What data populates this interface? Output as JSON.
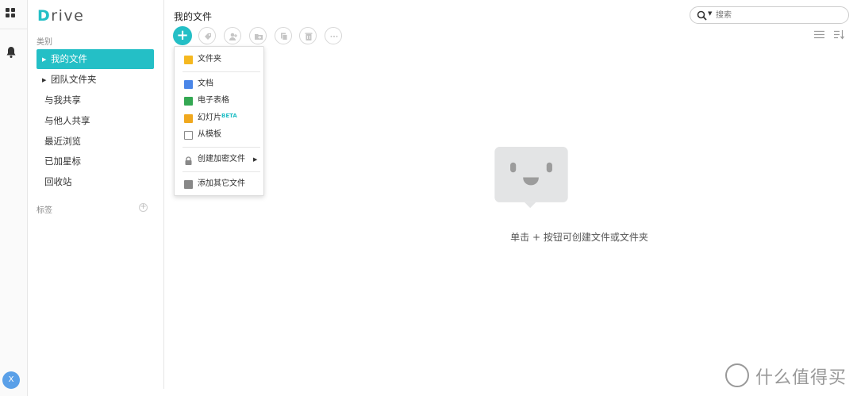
{
  "app": {
    "brand_initial": "D",
    "brand_rest": "rive"
  },
  "rail": {
    "avatar_letter": "X"
  },
  "sidebar": {
    "category_label": "类别",
    "items": [
      {
        "label": "我的文件",
        "expandable": true,
        "active": true
      },
      {
        "label": "团队文件夹",
        "expandable": true,
        "active": false
      },
      {
        "label": "与我共享"
      },
      {
        "label": "与他人共享"
      },
      {
        "label": "最近浏览"
      },
      {
        "label": "已加星标"
      },
      {
        "label": "回收站"
      }
    ],
    "tags_label": "标签",
    "tag_add": "+"
  },
  "main": {
    "title": "我的文件",
    "add_symbol": "+",
    "search_placeholder": "搜索",
    "empty_message": "单击 + 按钮可创建文件或文件夹"
  },
  "new_menu": {
    "folder": "文件夹",
    "doc": "文档",
    "sheet": "电子表格",
    "slides": "幻灯片",
    "slides_badge": "BETA",
    "template": "从模板",
    "encrypted": "创建加密文件",
    "other": "添加其它文件"
  },
  "watermark": {
    "text": "什么值得买"
  },
  "colors": {
    "accent": "#24bfc6",
    "folder": "#f5b820",
    "doc": "#4a86e8",
    "sheet": "#34a853",
    "slides": "#f0a81e"
  }
}
